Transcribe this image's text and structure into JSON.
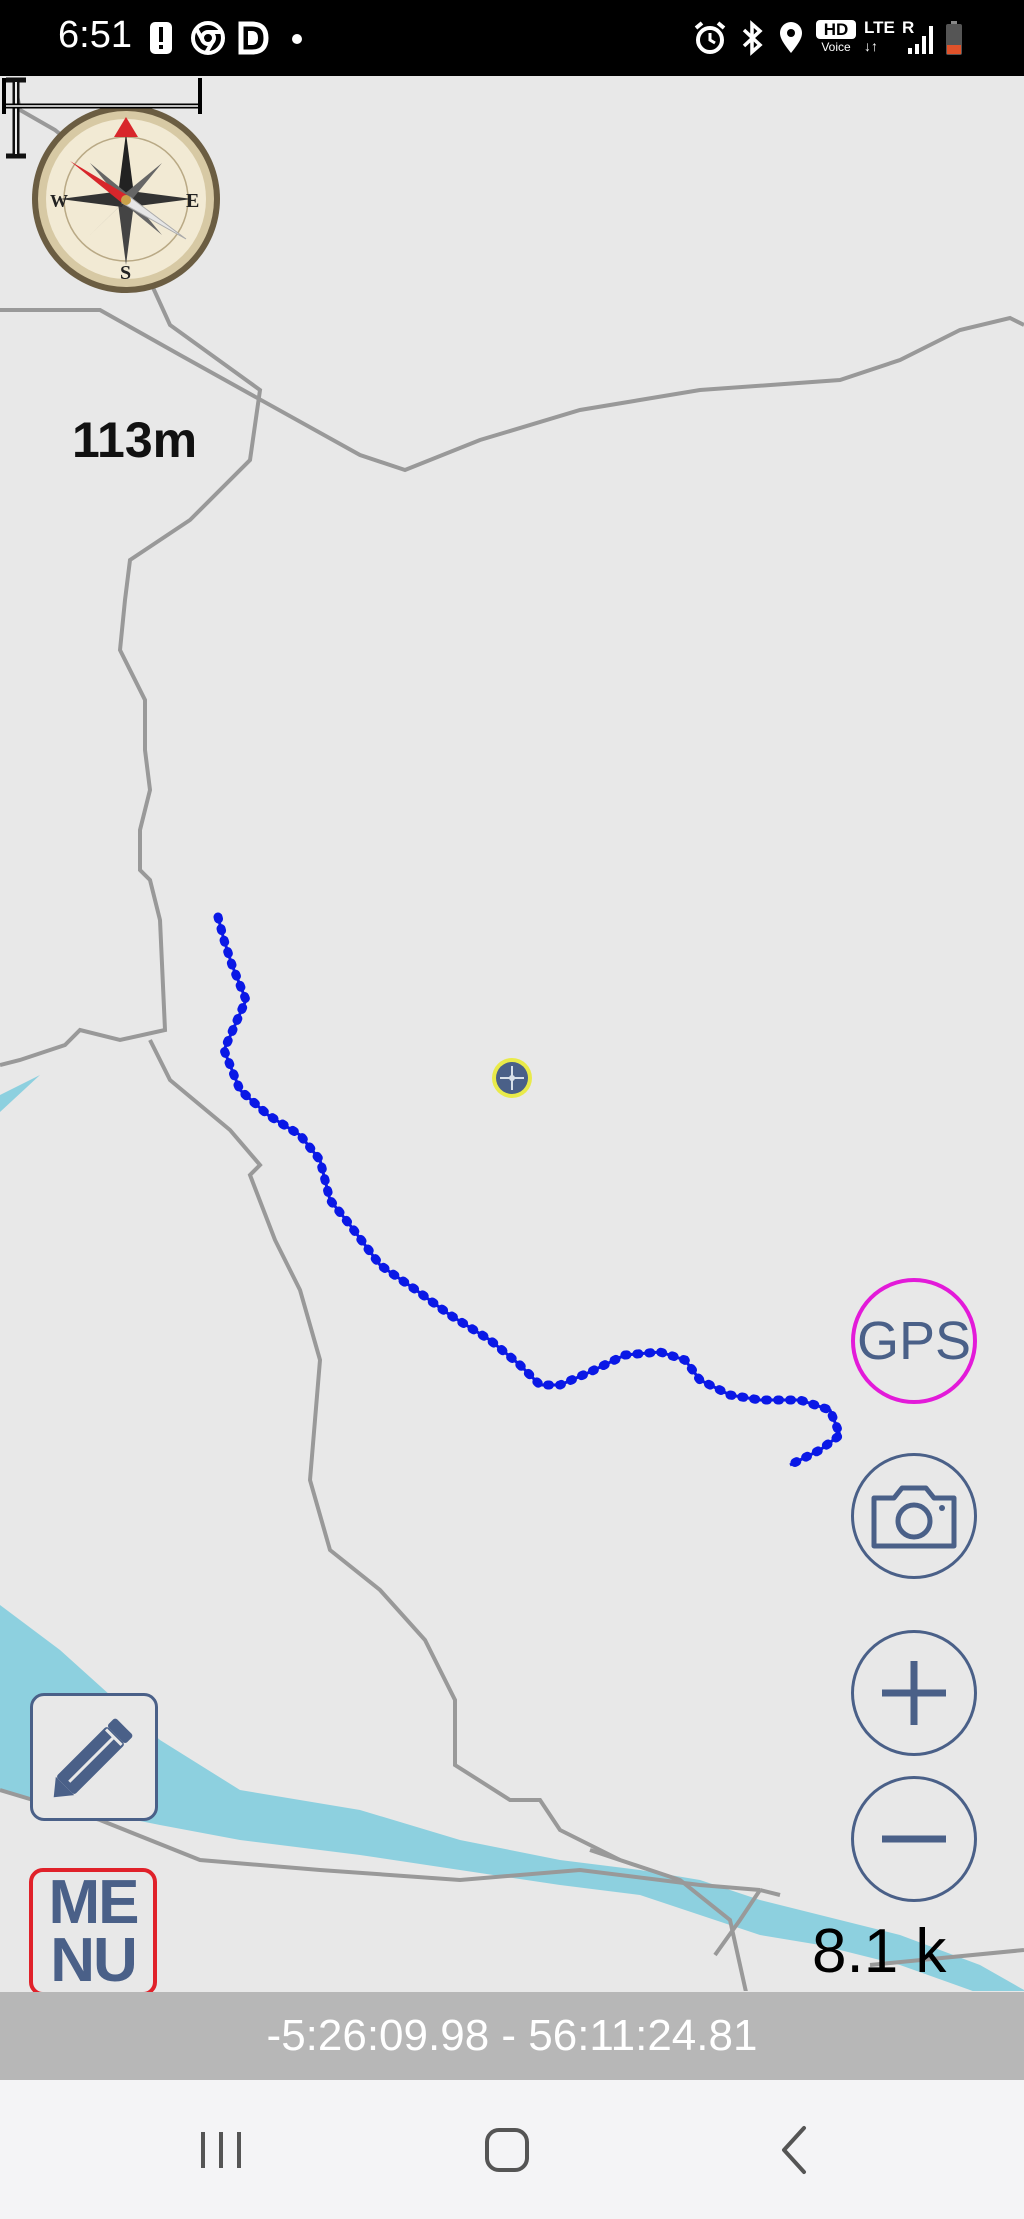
{
  "status_bar": {
    "time": "6:51",
    "left_icons": [
      "alert-icon",
      "chrome-icon",
      "d-app-icon",
      "dot-icon"
    ],
    "right_icons": [
      "alarm-icon",
      "bluetooth-icon",
      "location-icon",
      "hd-voice-icon",
      "lte-icon",
      "signal-icon",
      "battery-low-icon"
    ],
    "hd_voice": {
      "top": "HD",
      "bottom": "Voice"
    },
    "network": "LTE",
    "roaming": "R"
  },
  "map": {
    "altitude_label": "113m",
    "gps_label": "GPS",
    "menu_label": {
      "line1": "ME",
      "line2": "NU"
    },
    "scale_label": "8.1 k",
    "colors": {
      "background": "#e8e8e8",
      "road": "#999999",
      "water": "#8dd0df",
      "track": "#0a18e6",
      "gps_ring": "#e31ad9",
      "button_blue": "#4a6088",
      "menu_border": "#e0212a"
    }
  },
  "coordinates": "-5:26:09.98 - 56:11:24.81",
  "nav_bar": {
    "items": [
      "recent-apps-icon",
      "home-icon",
      "back-icon"
    ]
  }
}
